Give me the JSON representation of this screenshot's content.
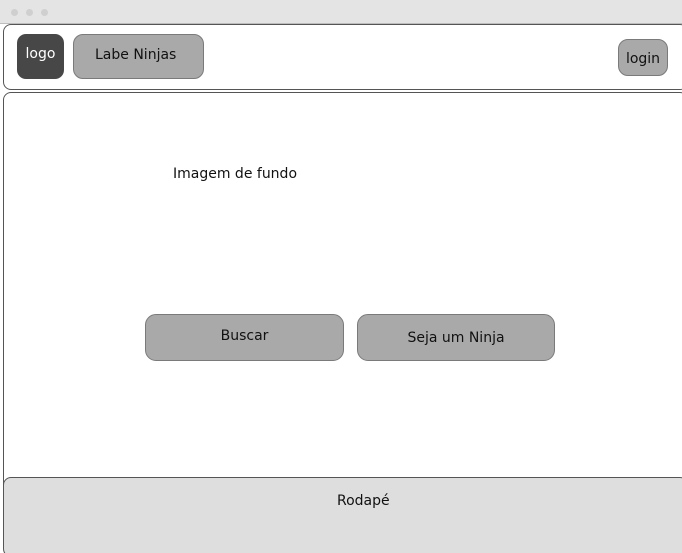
{
  "header": {
    "logo_label": "logo",
    "brand_label": "Labe Ninjas",
    "login_label": "login"
  },
  "main": {
    "background_image_label": "Imagem de fundo",
    "search_button_label": "Buscar",
    "become_ninja_button_label": "Seja um Ninja"
  },
  "footer": {
    "label": "Rodapé"
  },
  "colors": {
    "button_fill": "#a9a9a9",
    "logo_fill": "#474747",
    "footer_fill": "#dedede"
  }
}
